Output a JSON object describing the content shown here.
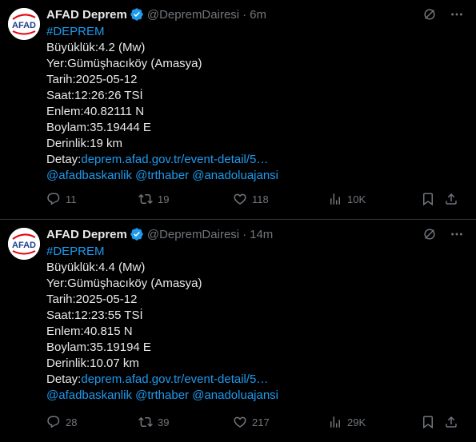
{
  "tweets": [
    {
      "author_name": "AFAD Deprem",
      "handle": "@DepremDairesi",
      "dot": "·",
      "time": "6m",
      "avatar_text": "AFAD",
      "hashtag": "#DEPREM",
      "lines": [
        "Büyüklük:4.2 (Mw)",
        "Yer:Gümüşhacıköy (Amasya)",
        "Tarih:2025-05-12",
        "Saat:12:26:26 TSİ",
        "Enlem:40.82111 N",
        "Boylam:35.19444 E",
        "Derinlik:19 km"
      ],
      "detail_label": "Detay:",
      "detail_link": "deprem.afad.gov.tr/event-detail/5…",
      "mentions": "@afadbaskanlik @trthaber @anadoluajansi",
      "replies": "11",
      "reposts": "19",
      "likes": "118",
      "views": "10K"
    },
    {
      "author_name": "AFAD Deprem",
      "handle": "@DepremDairesi",
      "dot": "·",
      "time": "14m",
      "avatar_text": "AFAD",
      "hashtag": "#DEPREM",
      "lines": [
        "Büyüklük:4.4 (Mw)",
        "Yer:Gümüşhacıköy (Amasya)",
        "Tarih:2025-05-12",
        "Saat:12:23:55 TSİ",
        "Enlem:40.815 N",
        "Boylam:35.19194 E",
        "Derinlik:10.07 km"
      ],
      "detail_label": "Detay:",
      "detail_link": "deprem.afad.gov.tr/event-detail/5…",
      "mentions": "@afadbaskanlik @trthaber @anadoluajansi",
      "replies": "28",
      "reposts": "39",
      "likes": "217",
      "views": "29K"
    }
  ],
  "colors": {
    "link": "#1d9bf0",
    "muted": "#71767b",
    "text": "#e7e9ea",
    "divider": "#2f3336",
    "afad_red": "#e30613",
    "afad_blue": "#1d3f8c"
  },
  "icons": [
    "afad-logo",
    "verified-badge-icon",
    "grok-icon",
    "more-icon",
    "reply-icon",
    "repost-icon",
    "like-icon",
    "views-icon",
    "bookmark-icon",
    "share-icon"
  ]
}
